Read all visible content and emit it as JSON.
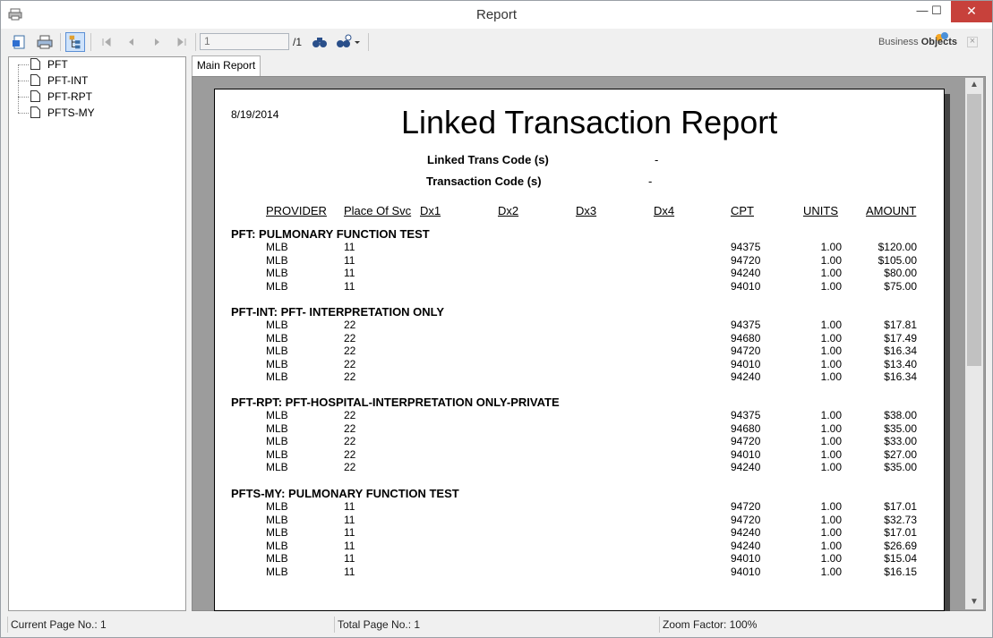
{
  "window": {
    "title": "Report",
    "minimize": "—",
    "maximize": "☐",
    "close": "✕"
  },
  "toolbar": {
    "page_value": "1",
    "page_total": "/1",
    "logo_a": "Business",
    "logo_b": "Objects"
  },
  "tree": {
    "items": [
      "PFT",
      "PFT-INT",
      "PFT-RPT",
      "PFTS-MY"
    ]
  },
  "tab": {
    "label": "Main Report"
  },
  "report": {
    "date": "8/19/2014",
    "title": "Linked Transaction Report",
    "linked_trans_label": "Linked Trans Code (s)",
    "linked_trans_value": "-",
    "trans_code_label": "Transaction Code (s)",
    "trans_code_value": "-",
    "columns": [
      "PROVIDER",
      "Place Of Svc",
      "Dx1",
      "Dx2",
      "Dx3",
      "Dx4",
      "CPT",
      "UNITS",
      "AMOUNT"
    ],
    "groups": [
      {
        "title": "PFT: PULMONARY FUNCTION TEST",
        "rows": [
          [
            "MLB",
            "11",
            "94375",
            "1.00",
            "$120.00"
          ],
          [
            "MLB",
            "11",
            "94720",
            "1.00",
            "$105.00"
          ],
          [
            "MLB",
            "11",
            "94240",
            "1.00",
            "$80.00"
          ],
          [
            "MLB",
            "11",
            "94010",
            "1.00",
            "$75.00"
          ]
        ]
      },
      {
        "title": "PFT-INT: PFT- INTERPRETATION ONLY",
        "rows": [
          [
            "MLB",
            "22",
            "94375",
            "1.00",
            "$17.81"
          ],
          [
            "MLB",
            "22",
            "94680",
            "1.00",
            "$17.49"
          ],
          [
            "MLB",
            "22",
            "94720",
            "1.00",
            "$16.34"
          ],
          [
            "MLB",
            "22",
            "94010",
            "1.00",
            "$13.40"
          ],
          [
            "MLB",
            "22",
            "94240",
            "1.00",
            "$16.34"
          ]
        ]
      },
      {
        "title": "PFT-RPT: PFT-HOSPITAL-INTERPRETATION ONLY-PRIVATE",
        "rows": [
          [
            "MLB",
            "22",
            "94375",
            "1.00",
            "$38.00"
          ],
          [
            "MLB",
            "22",
            "94680",
            "1.00",
            "$35.00"
          ],
          [
            "MLB",
            "22",
            "94720",
            "1.00",
            "$33.00"
          ],
          [
            "MLB",
            "22",
            "94010",
            "1.00",
            "$27.00"
          ],
          [
            "MLB",
            "22",
            "94240",
            "1.00",
            "$35.00"
          ]
        ]
      },
      {
        "title": "PFTS-MY: PULMONARY FUNCTION TEST",
        "rows": [
          [
            "MLB",
            "11",
            "94720",
            "1.00",
            "$17.01"
          ],
          [
            "MLB",
            "11",
            "94720",
            "1.00",
            "$32.73"
          ],
          [
            "MLB",
            "11",
            "94240",
            "1.00",
            "$17.01"
          ],
          [
            "MLB",
            "11",
            "94240",
            "1.00",
            "$26.69"
          ],
          [
            "MLB",
            "11",
            "94010",
            "1.00",
            "$15.04"
          ],
          [
            "MLB",
            "11",
            "94010",
            "1.00",
            "$16.15"
          ]
        ]
      }
    ]
  },
  "status": {
    "current_page": "Current Page No.: 1",
    "total_page": "Total Page No.: 1",
    "zoom": "Zoom Factor: 100%"
  }
}
